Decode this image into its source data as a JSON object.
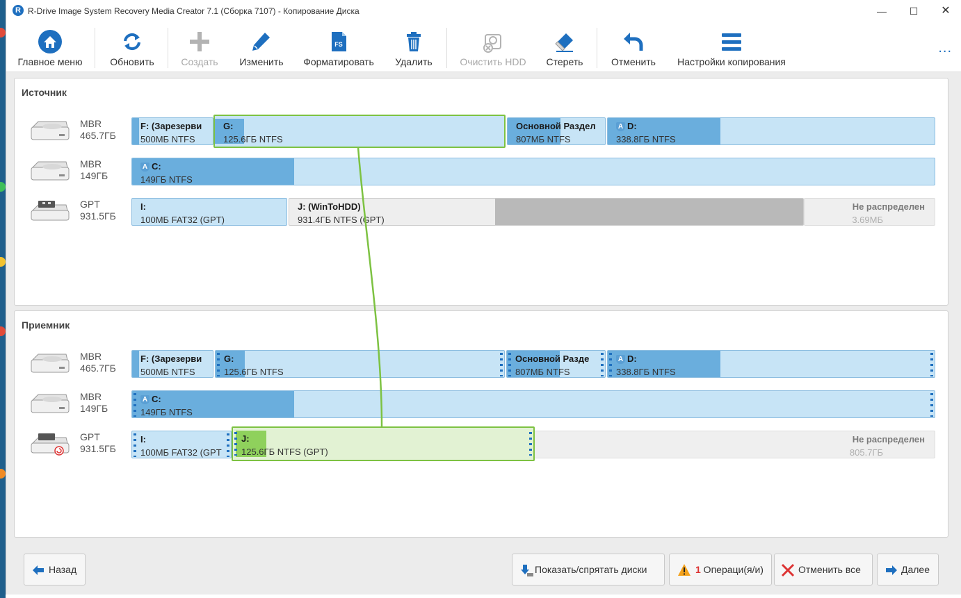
{
  "window": {
    "title": "R-Drive Image System Recovery Media Creator 7.1 (Сборка 7107) - Копирование Диска",
    "app_icon_letter": "R"
  },
  "toolbar": {
    "buttons": [
      {
        "label": "Главное меню",
        "icon": "home-icon",
        "enabled": true
      },
      {
        "label": "Обновить",
        "icon": "refresh-icon",
        "enabled": true
      },
      {
        "label": "Создать",
        "icon": "plus-icon",
        "enabled": false
      },
      {
        "label": "Изменить",
        "icon": "pencil-icon",
        "enabled": true
      },
      {
        "label": "Форматировать",
        "icon": "format-icon",
        "enabled": true
      },
      {
        "label": "Удалить",
        "icon": "trash-icon",
        "enabled": true
      },
      {
        "label": "Очистить HDD",
        "icon": "wipe-hdd-icon",
        "enabled": false
      },
      {
        "label": "Стереть",
        "icon": "eraser-icon",
        "enabled": true
      },
      {
        "label": "Отменить",
        "icon": "undo-icon",
        "enabled": true
      },
      {
        "label": "Настройки копирования",
        "icon": "menu-icon",
        "enabled": true
      }
    ],
    "more": "..."
  },
  "source": {
    "title": "Источник",
    "disks": [
      {
        "type": "MBR",
        "size": "465.7ГБ",
        "partitions": [
          {
            "name": "F: (Зарезерви",
            "info": "500МБ NTFS"
          },
          {
            "name": "G:",
            "info": "125.6ГБ NTFS"
          },
          {
            "name": "Основной Раздел",
            "info": "807МБ NTFS"
          },
          {
            "name": "D:",
            "info": "338.8ГБ NTFS"
          }
        ]
      },
      {
        "type": "MBR",
        "size": "149ГБ",
        "partitions": [
          {
            "name": "C:",
            "info": "149ГБ NTFS"
          }
        ]
      },
      {
        "type": "GPT",
        "size": "931.5ГБ",
        "partitions": [
          {
            "name": "I:",
            "info": "100МБ FAT32 (GPT)"
          },
          {
            "name": "J: (WinToHDD)",
            "info": "931.4ГБ NTFS (GPT)"
          },
          {
            "name": "Не распределен",
            "info": "3.69МБ"
          }
        ]
      }
    ]
  },
  "target": {
    "title": "Приемник",
    "disks": [
      {
        "type": "MBR",
        "size": "465.7ГБ",
        "partitions": [
          {
            "name": "F: (Зарезерви",
            "info": "500МБ NTFS"
          },
          {
            "name": "G:",
            "info": "125.6ГБ NTFS"
          },
          {
            "name": "Основной Разде",
            "info": "807МБ NTFS"
          },
          {
            "name": "D:",
            "info": "338.8ГБ NTFS"
          }
        ]
      },
      {
        "type": "MBR",
        "size": "149ГБ",
        "partitions": [
          {
            "name": "C:",
            "info": "149ГБ NTFS"
          }
        ]
      },
      {
        "type": "GPT",
        "size": "931.5ГБ",
        "partitions": [
          {
            "name": "I:",
            "info": "100МБ FAT32 (GPT"
          },
          {
            "name": "J:",
            "info": "125.6ГБ NTFS (GPT)"
          },
          {
            "name": "Не распределен",
            "info": "805.7ГБ"
          }
        ]
      }
    ]
  },
  "bottom": {
    "back": "Назад",
    "show_hide": "Показать/спрятать диски",
    "ops_count": "1",
    "ops_label": " Операци(я/и)",
    "cancel_all": "Отменить все",
    "next": "Далее"
  },
  "colors": {
    "accent": "#1e6fbf",
    "partition_fill": "#c7e4f6",
    "partition_used": "#6aaedd",
    "selection_green": "#7dc242"
  }
}
